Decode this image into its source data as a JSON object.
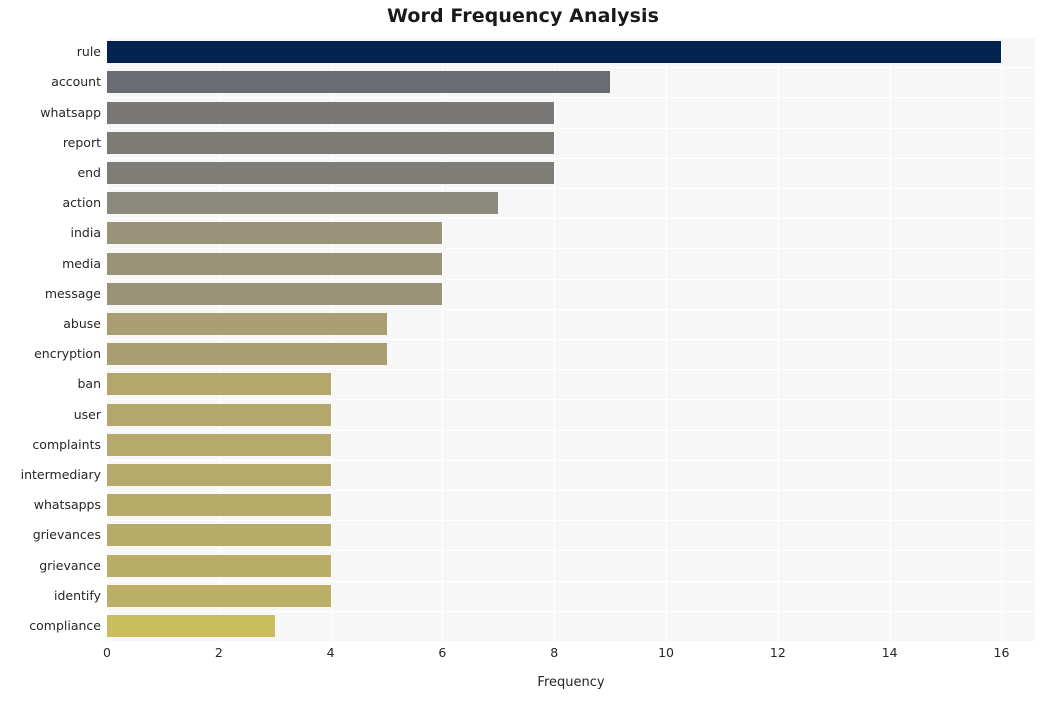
{
  "chart_data": {
    "type": "bar",
    "orientation": "horizontal",
    "title": "Word Frequency Analysis",
    "xlabel": "Frequency",
    "ylabel": "",
    "xlim": [
      0,
      16.6
    ],
    "ylim": [
      0,
      20
    ],
    "grid": true,
    "legend": null,
    "categories": [
      "rule",
      "account",
      "whatsapp",
      "report",
      "end",
      "action",
      "india",
      "media",
      "message",
      "abuse",
      "encryption",
      "ban",
      "user",
      "complaints",
      "intermediary",
      "whatsapps",
      "grievances",
      "grievance",
      "identify",
      "compliance"
    ],
    "values": [
      16,
      9,
      8,
      8,
      8,
      7,
      6,
      6,
      6,
      5,
      5,
      4,
      4,
      4,
      4,
      4,
      4,
      4,
      4,
      3
    ],
    "bar_colors": [
      "#052350",
      "#6a6c73",
      "#797876",
      "#7d7b76",
      "#7f7d77",
      "#8c8a7c",
      "#99937a",
      "#9a9377",
      "#9a9377",
      "#a89e72",
      "#a89e72",
      "#b3a76c",
      "#b3a76c",
      "#b5a96b",
      "#b5a96b",
      "#b7ab6a",
      "#b7ab6a",
      "#b9ad68",
      "#bbaf66",
      "#c9bd5e"
    ],
    "xticks": [
      0,
      2,
      4,
      6,
      8,
      10,
      12,
      14,
      16
    ],
    "xtick_labels": [
      "0",
      "2",
      "4",
      "6",
      "8",
      "10",
      "12",
      "14",
      "16"
    ],
    "plot_background": "#f7f7f7",
    "figure_background": "#ffffff",
    "gridline_color": "#ffffff"
  }
}
